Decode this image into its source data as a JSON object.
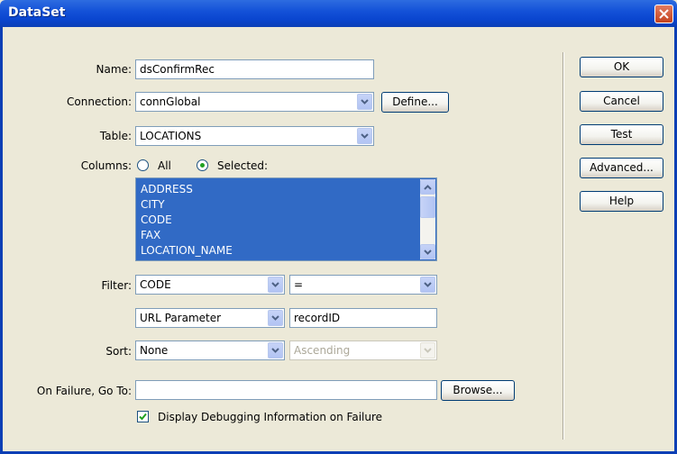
{
  "window": {
    "title": "DataSet"
  },
  "form": {
    "name_label": "Name:",
    "name_value": "dsConfirmRec",
    "connection_label": "Connection:",
    "connection_value": "connGlobal",
    "define_button": "Define...",
    "table_label": "Table:",
    "table_value": "LOCATIONS",
    "columns_label": "Columns:",
    "columns_all": "All",
    "columns_selected": "Selected:",
    "columns_mode": "Selected",
    "column_items": [
      "ADDRESS",
      "CITY",
      "CODE",
      "FAX",
      "LOCATION_NAME"
    ],
    "filter_label": "Filter:",
    "filter_column": "CODE",
    "filter_operator": "=",
    "filter_source": "URL Parameter",
    "filter_value": "recordID",
    "sort_label": "Sort:",
    "sort_column": "None",
    "sort_order": "Ascending",
    "failure_label": "On Failure, Go To:",
    "failure_value": "",
    "browse_button": "Browse...",
    "debug_label": "Display Debugging Information on Failure",
    "debug_checked": true
  },
  "buttons": {
    "ok": "OK",
    "cancel": "Cancel",
    "test": "Test",
    "advanced": "Advanced...",
    "help": "Help"
  },
  "icons": {
    "close": "close-icon",
    "dropdown": "chevron-down-icon",
    "scroll_up": "arrow-up-icon",
    "scroll_down": "arrow-down-icon",
    "check": "checkmark-icon"
  },
  "colors": {
    "title_bar": "#0A46D0",
    "selection": "#316AC5",
    "dialog_bg": "#ECE9D8"
  }
}
